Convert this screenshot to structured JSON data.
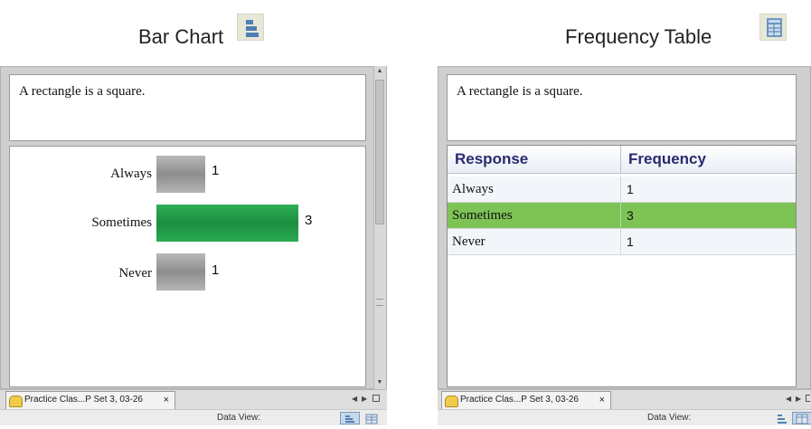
{
  "left": {
    "heading": "Bar Chart",
    "question": "A rectangle is a square.",
    "bars": [
      {
        "label": "Always",
        "count": 1,
        "count_text": "1",
        "color": "#9a9a9a",
        "highlighted": false
      },
      {
        "label": "Sometimes",
        "count": 3,
        "count_text": "3",
        "color": "#1f9a48",
        "highlighted": true
      },
      {
        "label": "Never",
        "count": 1,
        "count_text": "1",
        "color": "#9a9a9a",
        "highlighted": false
      }
    ],
    "tab_label": "Practice Clas...P Set 3, 03-26",
    "tab_close": "×",
    "status_label": "Data View:"
  },
  "right": {
    "heading": "Frequency Table",
    "question": "A rectangle is a square.",
    "columns": [
      "Response",
      "Frequency"
    ],
    "rows": [
      {
        "response": "Always",
        "frequency": "1",
        "highlighted": false
      },
      {
        "response": "Sometimes",
        "frequency": "3",
        "highlighted": true
      },
      {
        "response": "Never",
        "frequency": "1",
        "highlighted": false
      }
    ],
    "highlight_color": "#7dc356",
    "tab_label": "Practice Clas...P Set 3, 03-26",
    "tab_close": "×",
    "status_label": "Data View:"
  },
  "icons": {
    "bar_chart": "bar-chart-icon",
    "table": "table-icon",
    "tab": "calculator-icon"
  }
}
